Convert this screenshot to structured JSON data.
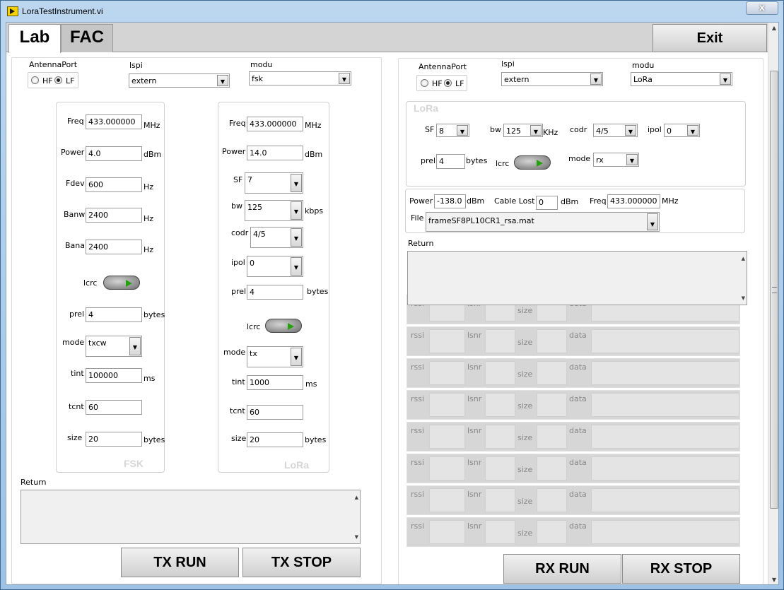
{
  "window": {
    "title": "LoraTestInstrument.vi",
    "close_label": "x"
  },
  "tabs": [
    {
      "label": "Lab"
    },
    {
      "label": "FAC"
    }
  ],
  "exit_label": "Exit",
  "tx": {
    "antenna_label": "AntennaPort",
    "hf_label": "HF",
    "lf_label": "LF",
    "lspi_label": "lspi",
    "lspi_value": "extern",
    "modu_label": "modu",
    "modu_value": "fsk",
    "fsk": {
      "freq_label": "Freq",
      "freq_value": "433.000000",
      "freq_unit": "MHz",
      "power_label": "Power",
      "power_value": "4.0",
      "power_unit": "dBm",
      "fdev_label": "Fdev",
      "fdev_value": "600",
      "fdev_unit": "Hz",
      "banw_label": "Banw",
      "banw_value": "2400",
      "banw_unit": "Hz",
      "bana_label": "Bana",
      "bana_value": "2400",
      "bana_unit": "Hz",
      "lcrc_label": "lcrc",
      "prel_label": "prel",
      "prel_value": "4",
      "prel_unit": "bytes",
      "mode_label": "mode",
      "mode_value": "txcw",
      "tint_label": "tint",
      "tint_value": "100000",
      "tint_unit": "ms",
      "tcnt_label": "tcnt",
      "tcnt_value": "60",
      "size_label": "size",
      "size_value": "20",
      "size_unit": "bytes",
      "watermark": "FSK"
    },
    "lora": {
      "freq_label": "Freq",
      "freq_value": "433.000000",
      "freq_unit": "MHz",
      "power_label": "Power",
      "power_value": "14.0",
      "power_unit": "dBm",
      "sf_label": "SF",
      "sf_value": "7",
      "bw_label": "bw",
      "bw_value": "125",
      "bw_unit": "kbps",
      "codr_label": "codr",
      "codr_value": "4/5",
      "ipol_label": "ipol",
      "ipol_value": "0",
      "prel_label": "prel",
      "prel_value": "4",
      "prel_unit": "bytes",
      "lcrc_label": "lcrc",
      "mode_label": "mode",
      "mode_value": "tx",
      "tint_label": "tint",
      "tint_value": "1000",
      "tint_unit": "ms",
      "tcnt_label": "tcnt",
      "tcnt_value": "60",
      "size_label": "size",
      "size_value": "20",
      "size_unit": "bytes",
      "watermark": "LoRa"
    },
    "return_label": "Return",
    "run_label": "TX RUN",
    "stop_label": "TX STOP"
  },
  "rx": {
    "antenna_label": "AntennaPort",
    "hf_label": "HF",
    "lf_label": "LF",
    "lspi_label": "lspi",
    "lspi_value": "extern",
    "modu_label": "modu",
    "modu_value": "LoRa",
    "lora": {
      "watermark": "LoRa",
      "sf_label": "SF",
      "sf_value": "8",
      "bw_label": "bw",
      "bw_value": "125",
      "bw_unit": "KHz",
      "codr_label": "codr",
      "codr_value": "4/5",
      "ipol_label": "ipol",
      "ipol_value": "0",
      "prel_label": "prel",
      "prel_value": "4",
      "prel_unit": "bytes",
      "lcrc_label": "lcrc",
      "mode_label": "mode",
      "mode_value": "rx"
    },
    "power_label": "Power",
    "power_value": "-138.0",
    "power_unit": "dBm",
    "cable_label": "Cable Lost",
    "cable_value": "0",
    "cable_unit": "dBm",
    "freq_label": "Freq",
    "freq_value": "433.000000",
    "freq_unit": "MHz",
    "file_label": "File",
    "file_value": "frameSF8PL10CR1_rsa.mat",
    "return_label": "Return",
    "row_labels": {
      "rssi": "rssi",
      "lsnr": "lsnr",
      "size": "size",
      "data": "data"
    },
    "run_label": "RX RUN",
    "stop_label": "RX STOP"
  }
}
